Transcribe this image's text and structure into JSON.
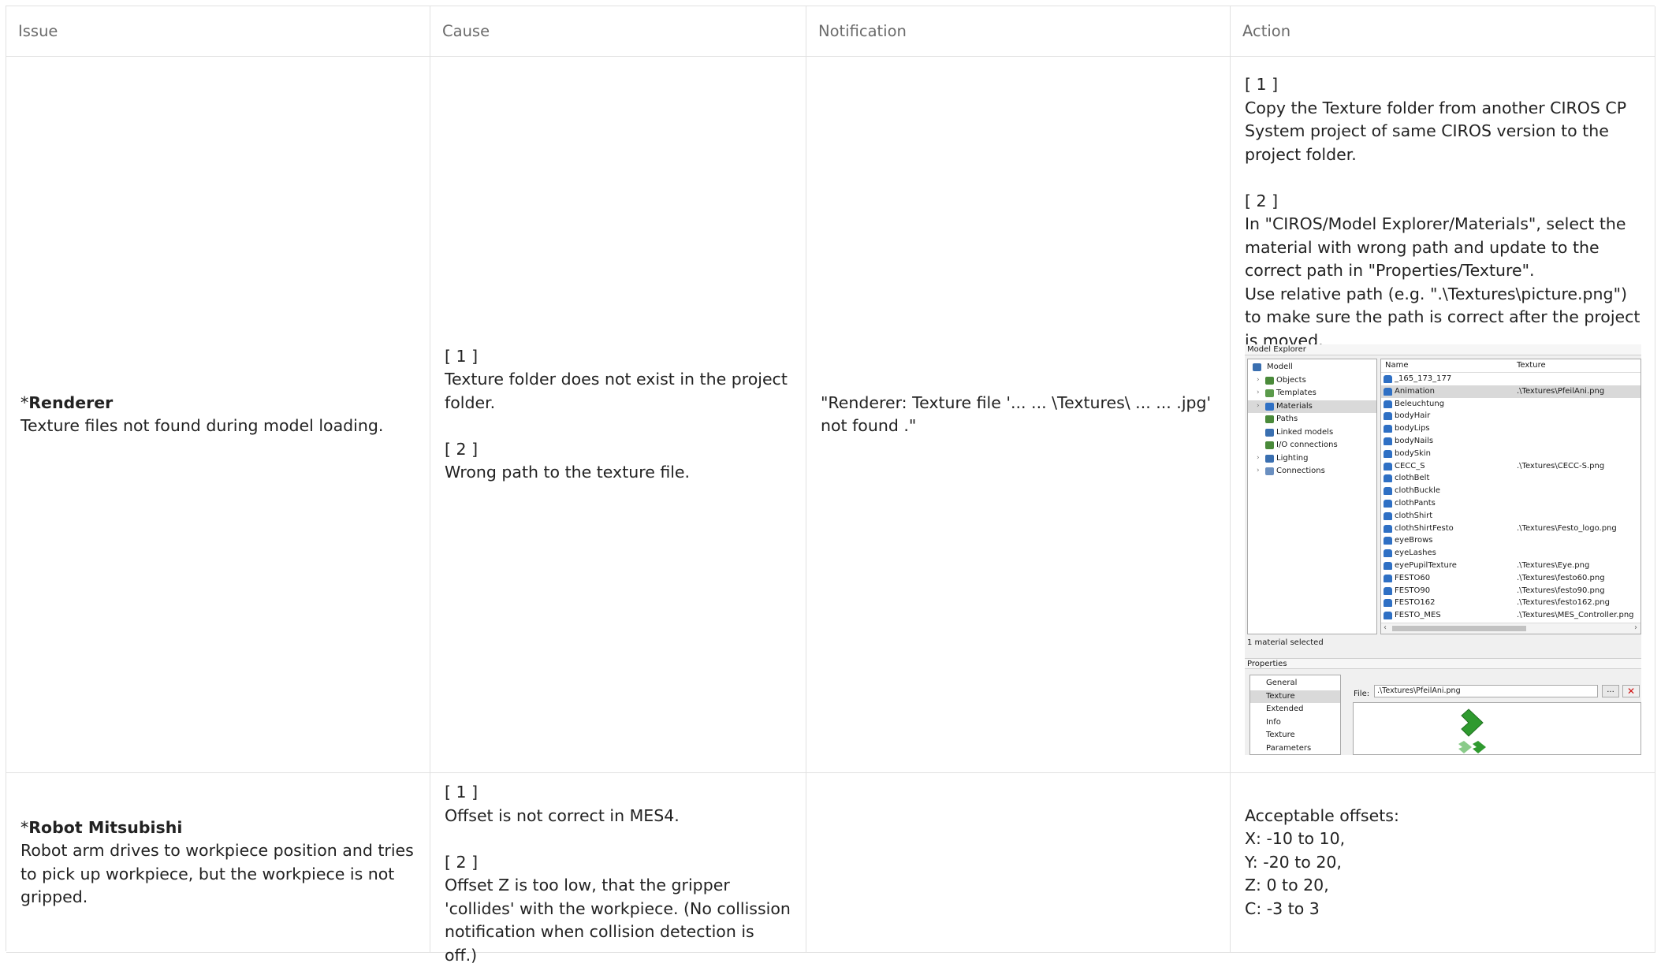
{
  "headers": [
    "Issue",
    "Cause",
    "Notification",
    "Action"
  ],
  "rows": [
    {
      "issue_prefix": "*",
      "issue_title": "Renderer",
      "issue_desc": "Texture files not found during model loading.",
      "cause": [
        {
          "marker": "[ 1 ]",
          "text": "Texture folder does not exist in the project folder."
        },
        {
          "marker": "[ 2 ]",
          "text": "Wrong path to the texture file."
        }
      ],
      "notification": "\"Renderer: Texture file '... ... \\Textures\\ ... ... .jpg' not found .\"",
      "action": [
        {
          "marker": "[ 1 ]",
          "text": "Copy the Texture folder from another CIROS CP System project of same CIROS version to the project folder."
        },
        {
          "marker": "[ 2 ]",
          "text": "In \"CIROS/Model Explorer/Materials\", select the material with wrong path and update to the correct path in \"Properties/Texture\".",
          "text2": "Use relative path (e.g. \".\\Textures\\picture.png\") to make sure the path is correct after the project is moved."
        }
      ]
    },
    {
      "issue_prefix": "*",
      "issue_title": "Robot Mitsubishi",
      "issue_desc": "Robot arm drives to workpiece position and tries to pick up workpiece, but the workpiece is not gripped.",
      "cause": [
        {
          "marker": "[ 1 ]",
          "text": "Offset is not correct in MES4."
        },
        {
          "marker": "[ 2 ]",
          "text": "Offset Z is too low, that the gripper 'collides' with the workpiece. (No collission notification when collision detection is off.)"
        }
      ],
      "notification": "",
      "action_lines": [
        "Acceptable offsets:",
        "X: -10 to 10,",
        "Y: -20 to 20,",
        "Z: 0 to 20,",
        "C: -3 to 3"
      ]
    }
  ],
  "screenshot": {
    "title": "Model Explorer",
    "tree": [
      {
        "label": "Modell",
        "icon": "house-icon",
        "color": "#3a6fb0"
      },
      {
        "label": "Objects",
        "icon": "objects-icon",
        "color": "#4a8a3a"
      },
      {
        "label": "Templates",
        "icon": "templates-icon",
        "color": "#4a8a3a"
      },
      {
        "label": "Materials",
        "icon": "materials-icon",
        "color": "#2f70c4"
      },
      {
        "label": "Paths",
        "icon": "paths-icon",
        "color": "#4a8a3a"
      },
      {
        "label": "Linked models",
        "icon": "linked-models-icon",
        "color": "#3a6fb0"
      },
      {
        "label": "I/O connections",
        "icon": "io-icon",
        "color": "#4a8a3a"
      },
      {
        "label": "Lighting",
        "icon": "lighting-icon",
        "color": "#3a6fb0"
      },
      {
        "label": "Connections",
        "icon": "connections-icon",
        "color": "#3a6fb0"
      }
    ],
    "col_name": "Name",
    "col_texture": "Texture",
    "materials": [
      {
        "name": "_165_173_177",
        "texture": ""
      },
      {
        "name": "Animation",
        "texture": ".\\Textures\\PfeilAni.png"
      },
      {
        "name": "Beleuchtung",
        "texture": ""
      },
      {
        "name": "bodyHair",
        "texture": ""
      },
      {
        "name": "bodyLips",
        "texture": ""
      },
      {
        "name": "bodyNails",
        "texture": ""
      },
      {
        "name": "bodySkin",
        "texture": ""
      },
      {
        "name": "CECC_S",
        "texture": ".\\Textures\\CECC-S.png"
      },
      {
        "name": "clothBelt",
        "texture": ""
      },
      {
        "name": "clothBuckle",
        "texture": ""
      },
      {
        "name": "clothPants",
        "texture": ""
      },
      {
        "name": "clothShirt",
        "texture": ""
      },
      {
        "name": "clothShirtFesto",
        "texture": ".\\Textures\\Festo_logo.png"
      },
      {
        "name": "eyeBrows",
        "texture": ""
      },
      {
        "name": "eyeLashes",
        "texture": ""
      },
      {
        "name": "eyePupilTexture",
        "texture": ".\\Textures\\Eye.png"
      },
      {
        "name": "FESTO60",
        "texture": ".\\Textures\\festo60.png"
      },
      {
        "name": "FESTO90",
        "texture": ".\\Textures\\festo90.png"
      },
      {
        "name": "FESTO162",
        "texture": ".\\Textures\\festo162.png"
      },
      {
        "name": "FESTO_MES",
        "texture": ".\\Textures\\MES_Controller.png"
      }
    ],
    "status": "1 material selected",
    "props_title": "Properties",
    "props_items": [
      "General",
      "Texture",
      "Extended",
      "Info",
      "Texture Parameters"
    ],
    "file_label": "File:",
    "file_value": ".\\Textures\\PfeilAni.png",
    "browse_label": "...",
    "delete_label": "✕"
  }
}
